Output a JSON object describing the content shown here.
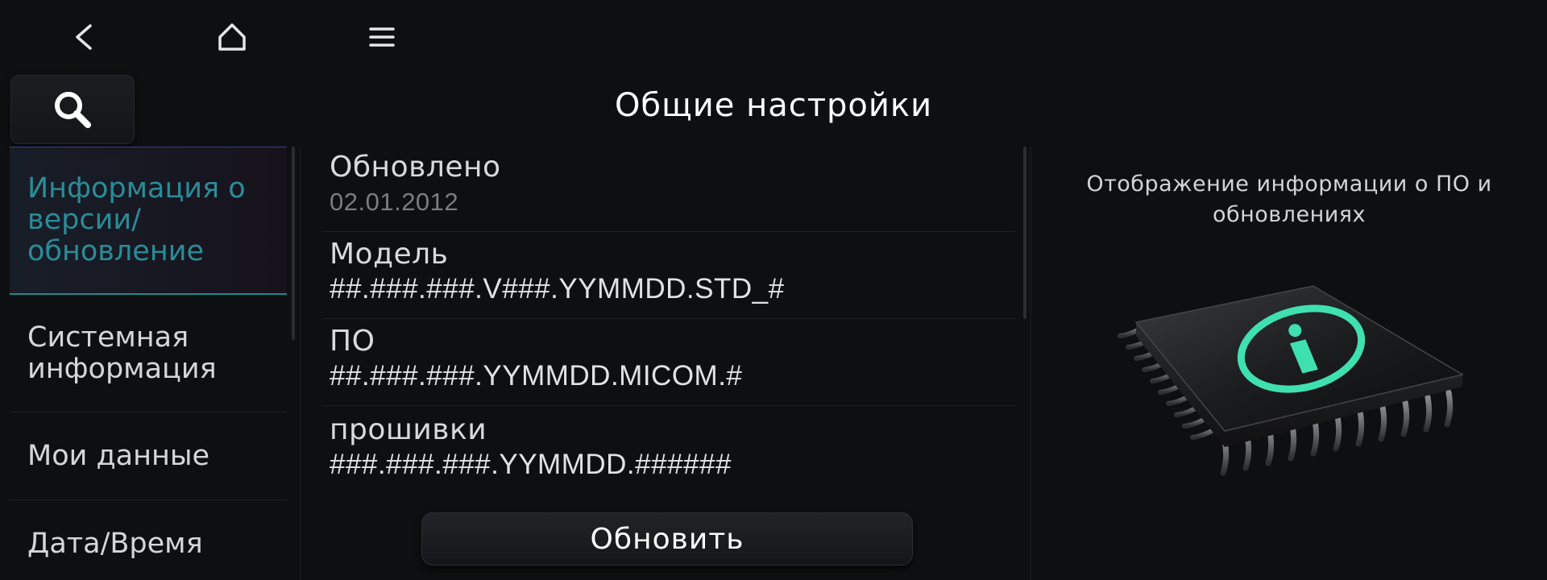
{
  "header": {
    "title": "Общие настройки"
  },
  "sidebar": {
    "items": [
      {
        "label": "Информация о версии/ обновление",
        "active": true
      },
      {
        "label": "Системная информация",
        "active": false
      },
      {
        "label": "Мои данные",
        "active": false
      },
      {
        "label": "Дата/Время",
        "active": false
      }
    ]
  },
  "info": {
    "rows": [
      {
        "label": "Обновлено",
        "value": "02.01.2012"
      },
      {
        "label": "Модель",
        "value": "##.###.###.V###.YYMMDD.STD_#"
      },
      {
        "label": "ПО",
        "value": "##.###.###.YYMMDD.MICOM.#"
      },
      {
        "label": "прошивки",
        "value": "###.###.###.YYMMDD.######"
      }
    ],
    "update_label": "Обновить"
  },
  "panel": {
    "description": "Отображение информации о ПО и обновлениях"
  },
  "colors": {
    "accent": "#2a8c98",
    "chip_ring": "#3fe0b0"
  },
  "icons": {
    "back": "back-arrow-icon",
    "home": "home-icon",
    "menu": "menu-icon",
    "search": "search-icon",
    "chip": "chip-info-icon"
  }
}
